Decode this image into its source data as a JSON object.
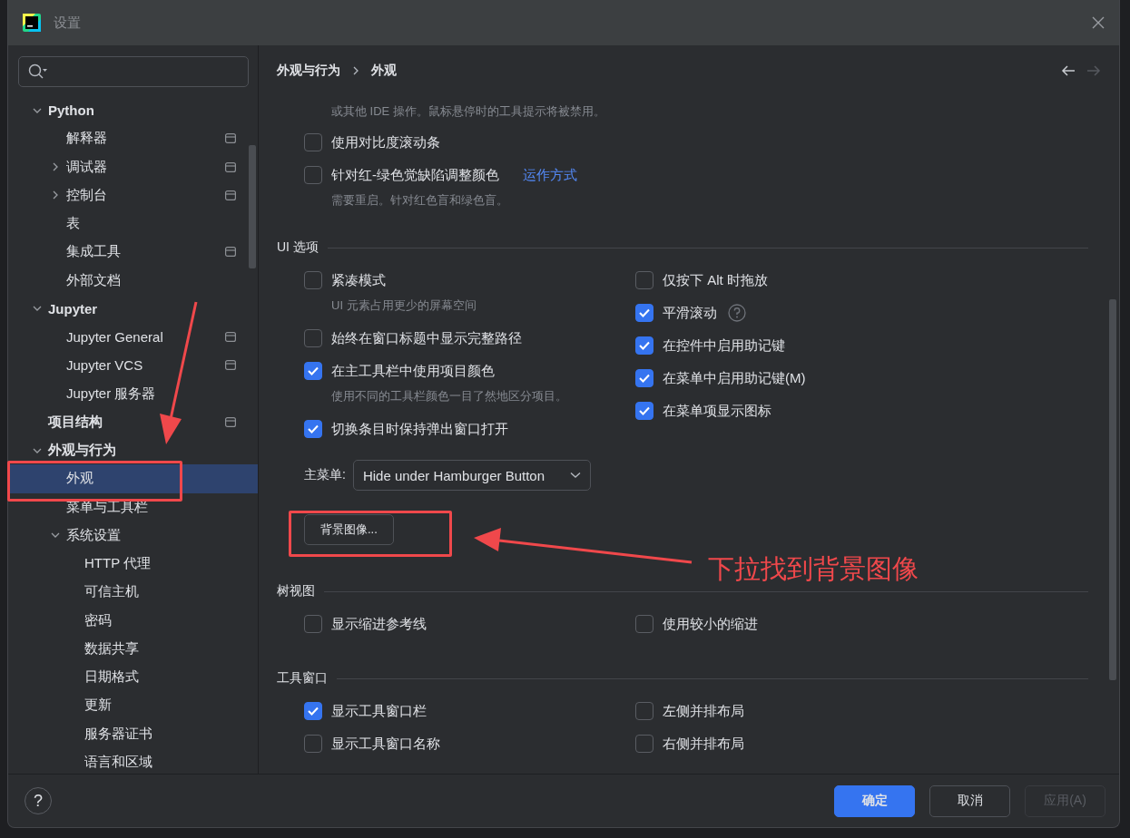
{
  "window": {
    "title": "设置"
  },
  "sidebar": {
    "items": [
      {
        "label": "Python",
        "expanded": true,
        "selected": false,
        "project_scope": false,
        "children": [
          {
            "label": "解释器",
            "selected": false,
            "project_scope": true
          },
          {
            "label": "调试器",
            "expanded": false,
            "selected": false,
            "project_scope": true
          },
          {
            "label": "控制台",
            "expanded": false,
            "selected": false,
            "project_scope": true
          },
          {
            "label": "表",
            "selected": false,
            "project_scope": false
          },
          {
            "label": "集成工具",
            "selected": false,
            "project_scope": true
          },
          {
            "label": "外部文档",
            "selected": false,
            "project_scope": false
          }
        ]
      },
      {
        "label": "Jupyter",
        "expanded": true,
        "selected": false,
        "project_scope": false,
        "children": [
          {
            "label": "Jupyter General",
            "selected": false,
            "project_scope": true
          },
          {
            "label": "Jupyter VCS",
            "selected": false,
            "project_scope": true
          },
          {
            "label": "Jupyter 服务器",
            "selected": false,
            "project_scope": false
          }
        ]
      },
      {
        "label": "项目结构",
        "selected": false,
        "project_scope": true
      },
      {
        "label": "外观与行为",
        "expanded": true,
        "selected": false,
        "project_scope": false,
        "children": [
          {
            "label": "外观",
            "selected": true,
            "project_scope": false
          },
          {
            "label": "菜单与工具栏",
            "selected": false,
            "project_scope": false
          },
          {
            "label": "系统设置",
            "expanded": true,
            "selected": false,
            "project_scope": false,
            "children": [
              {
                "label": "HTTP 代理",
                "selected": false,
                "project_scope": false
              },
              {
                "label": "可信主机",
                "selected": false,
                "project_scope": false
              },
              {
                "label": "密码",
                "selected": false,
                "project_scope": false
              },
              {
                "label": "数据共享",
                "selected": false,
                "project_scope": false
              },
              {
                "label": "日期格式",
                "selected": false,
                "project_scope": false
              },
              {
                "label": "更新",
                "selected": false,
                "project_scope": false
              },
              {
                "label": "服务器证书",
                "selected": false,
                "project_scope": false
              },
              {
                "label": "语言和区域",
                "selected": false,
                "project_scope": false
              }
            ]
          }
        ]
      }
    ]
  },
  "breadcrumb": [
    "外观与行为",
    "外观"
  ],
  "content": {
    "intro_hint": "或其他 IDE 操作。鼠标悬停时的工具提示将被禁用。",
    "top_options": [
      {
        "label": "使用对比度滚动条",
        "checked": false
      },
      {
        "label": "针对红-绿色觉缺陷调整颜色",
        "checked": false,
        "link": "运作方式",
        "hint": "需要重启。针对红色盲和绿色盲。"
      }
    ],
    "sections": [
      {
        "title": "UI 选项",
        "columns": [
          [
            {
              "label": "紧凑模式",
              "checked": false,
              "help": false,
              "hint": "UI 元素占用更少的屏幕空间"
            },
            {
              "label": "始终在窗口标题中显示完整路径",
              "checked": false,
              "help": false
            },
            {
              "label": "在主工具栏中使用项目颜色",
              "checked": true,
              "help": false,
              "hint": "使用不同的工具栏颜色一目了然地区分项目。"
            },
            {
              "label": "切换条目时保持弹出窗口打开",
              "checked": true,
              "help": false
            }
          ],
          [
            {
              "label": "仅按下 Alt 时拖放",
              "checked": false,
              "help": false
            },
            {
              "label": "平滑滚动",
              "checked": true,
              "help": true
            },
            {
              "label": "在控件中启用助记键",
              "checked": true,
              "help": false
            },
            {
              "label": "在菜单中启用助记键(M)",
              "checked": true,
              "help": false
            },
            {
              "label": "在菜单项显示图标",
              "checked": true,
              "help": false
            }
          ]
        ],
        "main_menu": {
          "label": "主菜单:",
          "value": "Hide under Hamburger Button"
        },
        "button": "背景图像..."
      },
      {
        "title": "树视图",
        "columns": [
          [
            {
              "label": "显示缩进参考线",
              "checked": false,
              "help": false
            }
          ],
          [
            {
              "label": "使用较小的缩进",
              "checked": false,
              "help": false
            }
          ]
        ]
      },
      {
        "title": "工具窗口",
        "columns": [
          [
            {
              "label": "显示工具窗口栏",
              "checked": true,
              "help": false
            },
            {
              "label": "显示工具窗口名称",
              "checked": false,
              "help": false
            }
          ],
          [
            {
              "label": "左侧并排布局",
              "checked": false,
              "help": false
            },
            {
              "label": "右侧并排布局",
              "checked": false,
              "help": false
            }
          ]
        ]
      }
    ]
  },
  "footer": {
    "help": "?",
    "buttons": [
      {
        "label": "确定",
        "kind": "primary",
        "disabled": false
      },
      {
        "label": "取消",
        "kind": "normal",
        "disabled": false
      },
      {
        "label": "应用(A)",
        "kind": "normal",
        "disabled": true
      }
    ]
  },
  "annotation": {
    "text": "下拉找到背景图像"
  }
}
